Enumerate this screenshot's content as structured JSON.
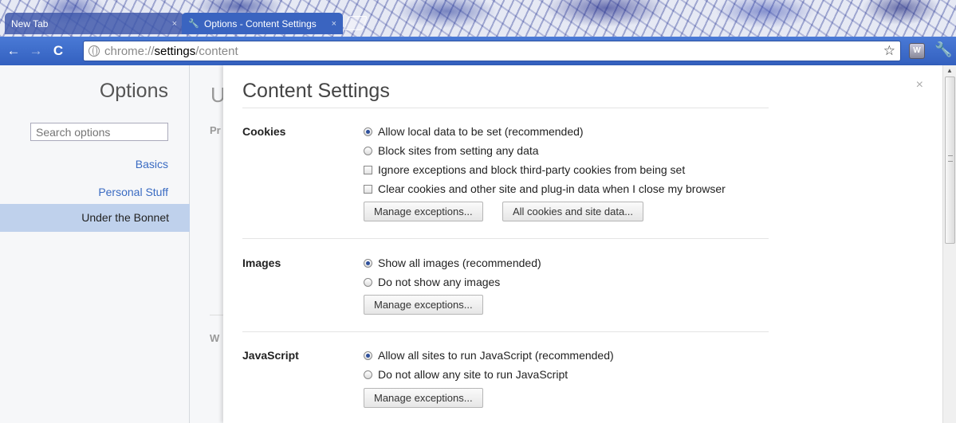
{
  "browser": {
    "tabs": [
      {
        "label": "New Tab",
        "close": "×"
      },
      {
        "label": "Options - Content Settings",
        "close": "×"
      }
    ],
    "url_prefix": "chrome://",
    "url_host": "settings",
    "url_path": "/content",
    "icons": {
      "back": "←",
      "forward": "→",
      "reload": "C",
      "star": "☆",
      "wrench": "🔧",
      "extension": "W"
    }
  },
  "sidebar": {
    "title": "Options",
    "search_placeholder": "Search options",
    "items": [
      {
        "label": "Basics"
      },
      {
        "label": "Personal Stuff"
      },
      {
        "label": "Under the Bonnet"
      }
    ]
  },
  "background_page": {
    "title": "U",
    "section1": "Pr",
    "section2": "W"
  },
  "dialog": {
    "title": "Content Settings",
    "close": "×",
    "sections": {
      "cookies": {
        "label": "Cookies",
        "options": [
          "Allow local data to be set (recommended)",
          "Block sites from setting any data",
          "Ignore exceptions and block third-party cookies from being set",
          "Clear cookies and other site and plug-in data when I close my browser"
        ],
        "buttons": [
          "Manage exceptions...",
          "All cookies and site data..."
        ]
      },
      "images": {
        "label": "Images",
        "options": [
          "Show all images (recommended)",
          "Do not show any images"
        ],
        "buttons": [
          "Manage exceptions..."
        ]
      },
      "javascript": {
        "label": "JavaScript",
        "options": [
          "Allow all sites to run JavaScript (recommended)",
          "Do not allow any site to run JavaScript"
        ],
        "buttons": [
          "Manage exceptions..."
        ]
      }
    }
  },
  "colors": {
    "toolbar": "#3360bf",
    "selected_nav": "#bfd1ec",
    "link": "#3a6bc2"
  }
}
